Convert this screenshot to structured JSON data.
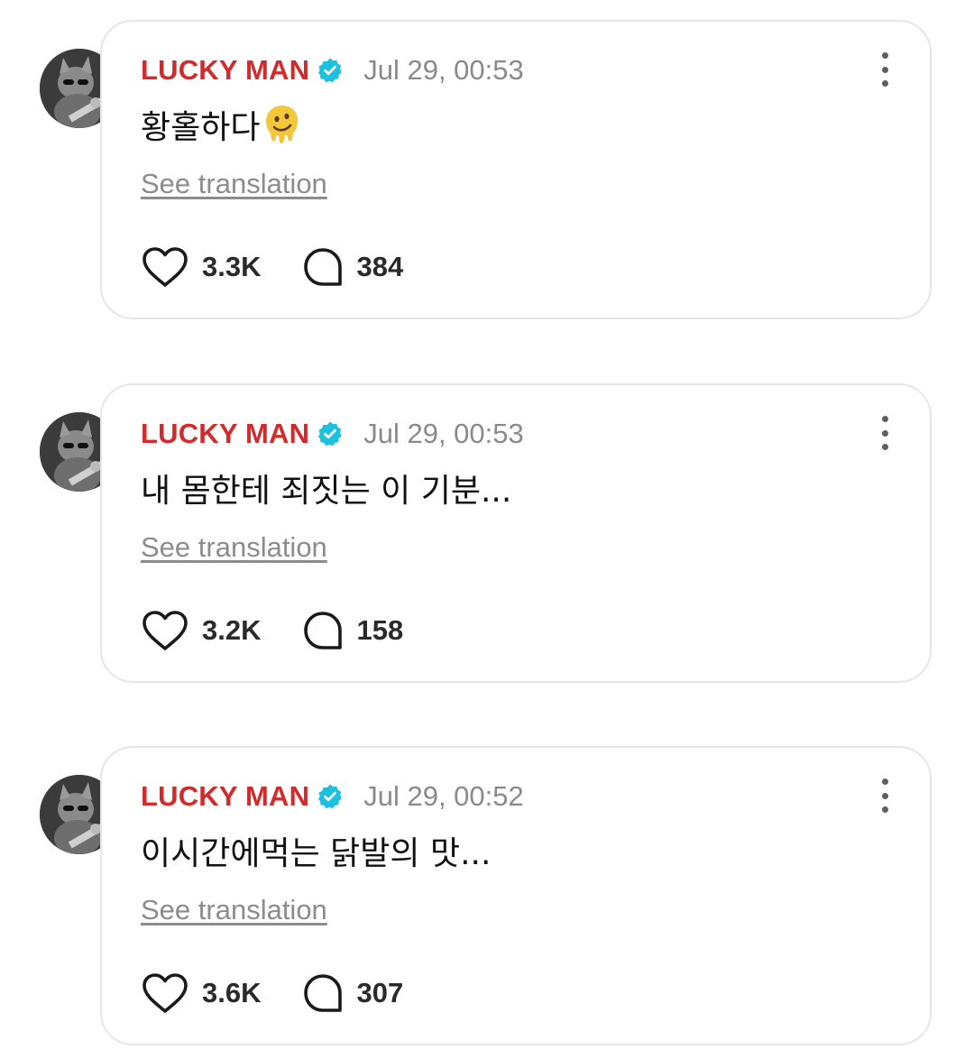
{
  "posts": [
    {
      "author": "LUCKY MAN",
      "timestamp": "Jul 29, 00:53",
      "text": "황홀하다",
      "emoji": "melting-face",
      "translate_label": "See translation",
      "likes": "3.3K",
      "replies": "384"
    },
    {
      "author": "LUCKY MAN",
      "timestamp": "Jul 29, 00:53",
      "text": "내 몸한테 죄짓는 이 기분...",
      "translate_label": "See translation",
      "likes": "3.2K",
      "replies": "158"
    },
    {
      "author": "LUCKY MAN",
      "timestamp": "Jul 29, 00:52",
      "text": "이시간에먹는 닭발의 맛...",
      "translate_label": "See translation",
      "likes": "3.6K",
      "replies": "307"
    }
  ],
  "icons": {
    "verified": "verified-badge-icon",
    "more": "more-vertical-icon",
    "like": "heart-icon",
    "reply": "comment-bubble-icon"
  },
  "colors": {
    "author": "#d12b2b",
    "verified": "#1ec0e0",
    "timestamp": "#8a8a8a",
    "card_border": "#e6e6e6"
  }
}
